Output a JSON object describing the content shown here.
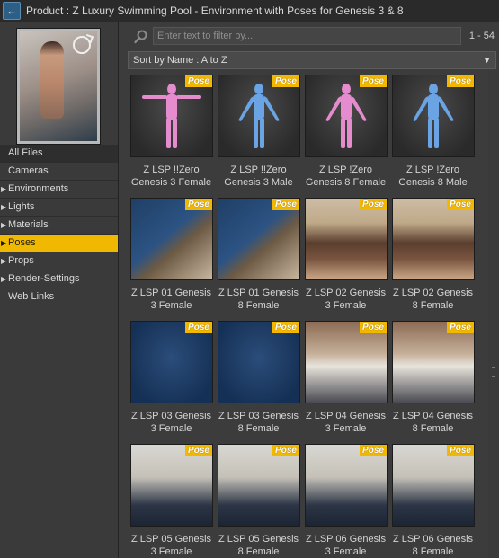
{
  "titlebar": {
    "back_icon": "back-arrow-icon",
    "title": "Product :  Z Luxury Swimming Pool - Environment with Poses for Genesis 3 & 8"
  },
  "sidebar": {
    "items": [
      {
        "label": "All Files",
        "has_children": false,
        "active": false
      },
      {
        "label": "Cameras",
        "has_children": false,
        "active": false
      },
      {
        "label": "Environments",
        "has_children": true,
        "active": false
      },
      {
        "label": "Lights",
        "has_children": true,
        "active": false
      },
      {
        "label": "Materials",
        "has_children": true,
        "active": false
      },
      {
        "label": "Poses",
        "has_children": true,
        "active": true
      },
      {
        "label": "Props",
        "has_children": true,
        "active": false
      },
      {
        "label": "Render-Settings",
        "has_children": true,
        "active": false
      },
      {
        "label": "Web Links",
        "has_children": false,
        "active": false
      }
    ]
  },
  "filter": {
    "placeholder": "Enter text to filter by...",
    "range": "1 - 54"
  },
  "sort": {
    "label": "Sort by Name : A to Z"
  },
  "badge": "Pose",
  "tiles": [
    {
      "line1": "Z LSP !!Zero",
      "line2": "Genesis 3 Female",
      "style": "mannequin-pink"
    },
    {
      "line1": "Z LSP !!Zero",
      "line2": "Genesis 3 Male",
      "style": "mannequin-blue"
    },
    {
      "line1": "Z LSP !Zero",
      "line2": "Genesis 8 Female",
      "style": "mannequin-pink"
    },
    {
      "line1": "Z LSP !Zero",
      "line2": "Genesis 8 Male",
      "style": "mannequin-blue"
    },
    {
      "line1": "Z LSP 01 Genesis",
      "line2": "3 Female",
      "style": "pool"
    },
    {
      "line1": "Z LSP 01 Genesis",
      "line2": "8 Female",
      "style": "pool"
    },
    {
      "line1": "Z LSP 02 Genesis",
      "line2": "3 Female",
      "style": "rim"
    },
    {
      "line1": "Z LSP 02 Genesis",
      "line2": "8 Female",
      "style": "rim"
    },
    {
      "line1": "Z LSP 03 Genesis",
      "line2": "3 Female",
      "style": "water"
    },
    {
      "line1": "Z LSP 03 Genesis",
      "line2": "8 Female",
      "style": "water"
    },
    {
      "line1": "Z LSP 04 Genesis",
      "line2": "3 Female",
      "style": "step"
    },
    {
      "line1": "Z LSP 04 Genesis",
      "line2": "8 Female",
      "style": "step"
    },
    {
      "line1": "Z LSP 05 Genesis",
      "line2": "3 Female",
      "style": "ladder"
    },
    {
      "line1": "Z LSP 05 Genesis",
      "line2": "8 Female",
      "style": "ladder"
    },
    {
      "line1": "Z LSP 06 Genesis",
      "line2": "3 Female",
      "style": "ladder"
    },
    {
      "line1": "Z LSP 06 Genesis",
      "line2": "8 Female",
      "style": "ladder"
    }
  ],
  "colors": {
    "active_nav": "#f0b800",
    "badge": "#f2b800",
    "mannequin_pink": "#e58ccf",
    "mannequin_blue": "#6aa4e4"
  }
}
